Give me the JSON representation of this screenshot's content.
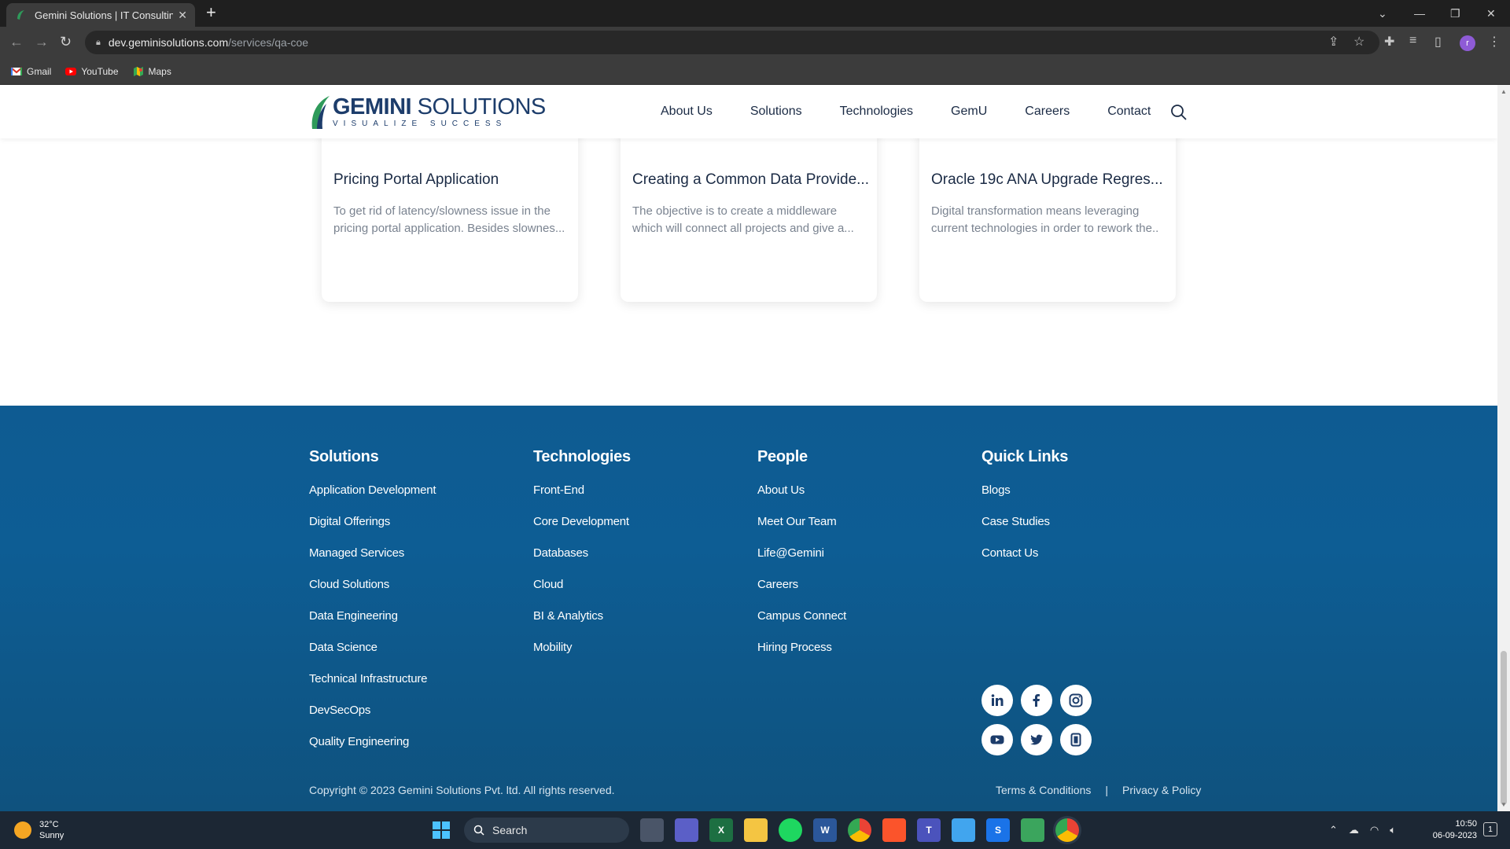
{
  "browser": {
    "tab_title": "Gemini Solutions | IT Consulting,",
    "url_domain": "dev.geminisolutions.com",
    "url_path": "/services/qa-coe",
    "bookmarks": [
      "Gmail",
      "YouTube",
      "Maps"
    ],
    "profile_initial": "r"
  },
  "site": {
    "logo_name_bold": "GEMINI",
    "logo_name_rest": " SOLUTIONS",
    "logo_tagline": "VISUALIZE SUCCESS",
    "nav": [
      "About Us",
      "Solutions",
      "Technologies",
      "GemU",
      "Careers",
      "Contact"
    ]
  },
  "cards": [
    {
      "title": "Pricing Portal Application",
      "desc": "To get rid of latency/slowness issue in the pricing portal application. Besides slownes..."
    },
    {
      "title": "Creating a Common Data Provide...",
      "desc": "The objective is to create a middleware which will connect all projects and give a..."
    },
    {
      "title": "Oracle 19c ANA Upgrade Regres...",
      "desc": "Digital transformation means leveraging current technologies in order to rework the.."
    }
  ],
  "footer": {
    "columns": [
      {
        "heading": "Solutions",
        "links": [
          "Application Development",
          "Digital Offerings",
          "Managed Services",
          "Cloud Solutions",
          "Data Engineering",
          "Data Science",
          "Technical Infrastructure",
          "DevSecOps",
          "Quality Engineering"
        ]
      },
      {
        "heading": "Technologies",
        "links": [
          "Front-End",
          "Core Development",
          "Databases",
          "Cloud",
          "BI & Analytics",
          "Mobility"
        ]
      },
      {
        "heading": "People",
        "links": [
          "About Us",
          "Meet Our Team",
          "Life@Gemini",
          "Careers",
          "Campus Connect",
          "Hiring Process"
        ]
      },
      {
        "heading": "Quick Links",
        "links": [
          "Blogs",
          "Case Studies",
          "Contact Us"
        ]
      }
    ],
    "social_icons": [
      "linkedin-icon",
      "facebook-icon",
      "instagram-icon",
      "youtube-icon",
      "twitter-icon",
      "tiktok-icon"
    ],
    "copyright": "Copyright © 2023 Gemini Solutions Pvt. ltd. All rights reserved.",
    "terms": "Terms & Conditions",
    "separator": "|",
    "privacy": "Privacy & Policy"
  },
  "taskbar": {
    "temperature": "32°C",
    "weather": "Sunny",
    "search_label": "Search",
    "time": "10:50",
    "date": "06-09-2023"
  },
  "colors": {
    "footer_blue": "#0e5b92",
    "brand_navy": "#1d3d6b",
    "logo_green": "#2e9a5a"
  }
}
